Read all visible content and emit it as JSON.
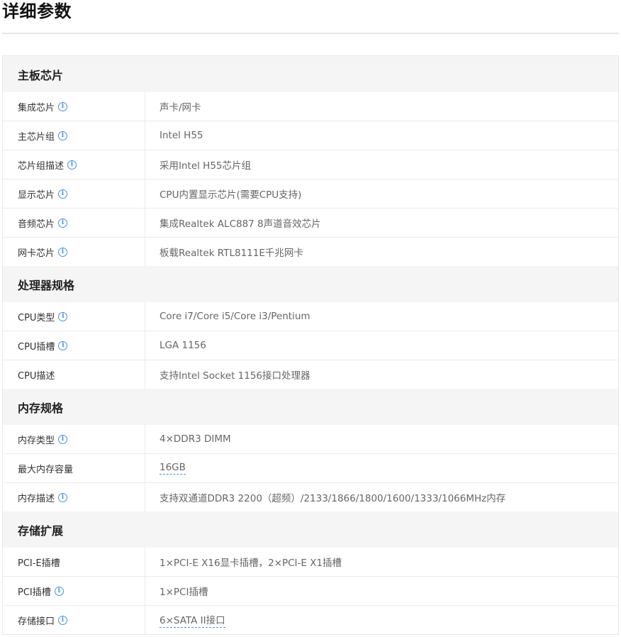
{
  "page_title": "详细参数",
  "sections": [
    {
      "title": "主板芯片",
      "rows": [
        {
          "name": "集成芯片",
          "value": "声卡/网卡",
          "has_info": true
        },
        {
          "name": "主芯片组",
          "value": "Intel H55",
          "has_info": true
        },
        {
          "name": "芯片组描述",
          "value": "采用Intel H55芯片组",
          "has_info": true
        },
        {
          "name": "显示芯片",
          "value": "CPU内置显示芯片(需要CPU支持)",
          "has_info": true
        },
        {
          "name": "音频芯片",
          "value": "集成Realtek ALC887 8声道音效芯片",
          "has_info": true
        },
        {
          "name": "网卡芯片",
          "value": "板载Realtek RTL8111E千兆网卡",
          "has_info": true
        }
      ]
    },
    {
      "title": "处理器规格",
      "rows": [
        {
          "name": "CPU类型",
          "value": "Core i7/Core i5/Core i3/Pentium",
          "has_info": true
        },
        {
          "name": "CPU插槽",
          "value": "LGA 1156",
          "has_info": true
        },
        {
          "name": "CPU描述",
          "value": "支持Intel Socket 1156接口处理器",
          "has_info": false
        }
      ]
    },
    {
      "title": "内存规格",
      "rows": [
        {
          "name": "内存类型",
          "value": "4×DDR3 DIMM",
          "has_info": true
        },
        {
          "name": "最大内存容量",
          "value": "16GB",
          "has_info": false,
          "link": true
        },
        {
          "name": "内存描述",
          "value": "支持双通道DDR3 2200（超频）/2133/1866/1800/1600/1333/1066MHz内存",
          "has_info": true
        }
      ]
    },
    {
      "title": "存储扩展",
      "rows": [
        {
          "name": "PCI-E插槽",
          "value": "1×PCI-E X16显卡插槽，2×PCI-E X1插槽",
          "has_info": false
        },
        {
          "name": "PCI插槽",
          "value": "1×PCI插槽",
          "has_info": true
        },
        {
          "name": "存储接口",
          "value": "6×SATA II接口",
          "has_info": true,
          "link": true
        }
      ]
    }
  ],
  "icons": {
    "info": "info-circle-icon"
  },
  "colors": {
    "accent": "#4a90e2",
    "section_bg": "#f5f5f5",
    "border": "#e8e8e8"
  }
}
